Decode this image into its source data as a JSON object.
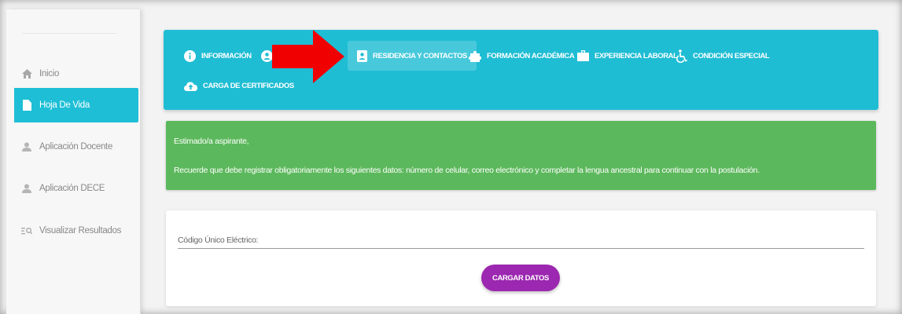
{
  "sidebar": {
    "items": [
      {
        "label": "Inicio",
        "icon": "home-icon"
      },
      {
        "label": "Hoja De Vida",
        "icon": "document-icon",
        "active": true
      },
      {
        "label": "Aplicación Docente",
        "icon": "user-icon"
      },
      {
        "label": "Aplicación DECE",
        "icon": "user-icon"
      },
      {
        "label": "Visualizar Resultados",
        "icon": "list-search-icon"
      }
    ]
  },
  "tabs": [
    {
      "label": "INFORMACIÓN",
      "icon": "info-icon"
    },
    {
      "label": "",
      "icon": "account-icon"
    },
    {
      "label": "RESIDENCIA Y CONTACTOS",
      "icon": "contact-card-icon",
      "active": true
    },
    {
      "label": "FORMACIÓN ACADÉMICA",
      "icon": "puzzle-icon"
    },
    {
      "label": "EXPERIENCIA LABORAL",
      "icon": "briefcase-icon"
    },
    {
      "label": "CONDICIÓN ESPECIAL",
      "icon": "wheelchair-icon"
    },
    {
      "label": "CARGA DE CERTIFICADOS",
      "icon": "cloud-upload-icon"
    }
  ],
  "notice": {
    "line1": "Estimado/a aspirante,",
    "line2": "Recuerde que debe registrar obligatoriamente los siguientes datos: número de celular, correo electrónico y completar la lengua ancestral para continuar con la postulación."
  },
  "form": {
    "field_label": "Código Único Eléctrico:",
    "field_value": "",
    "button_label": "CARGAR DATOS"
  },
  "colors": {
    "accent": "#1fbdd4",
    "notice": "#5cb85c",
    "button": "#9c27b0",
    "arrow": "#ff0000"
  }
}
